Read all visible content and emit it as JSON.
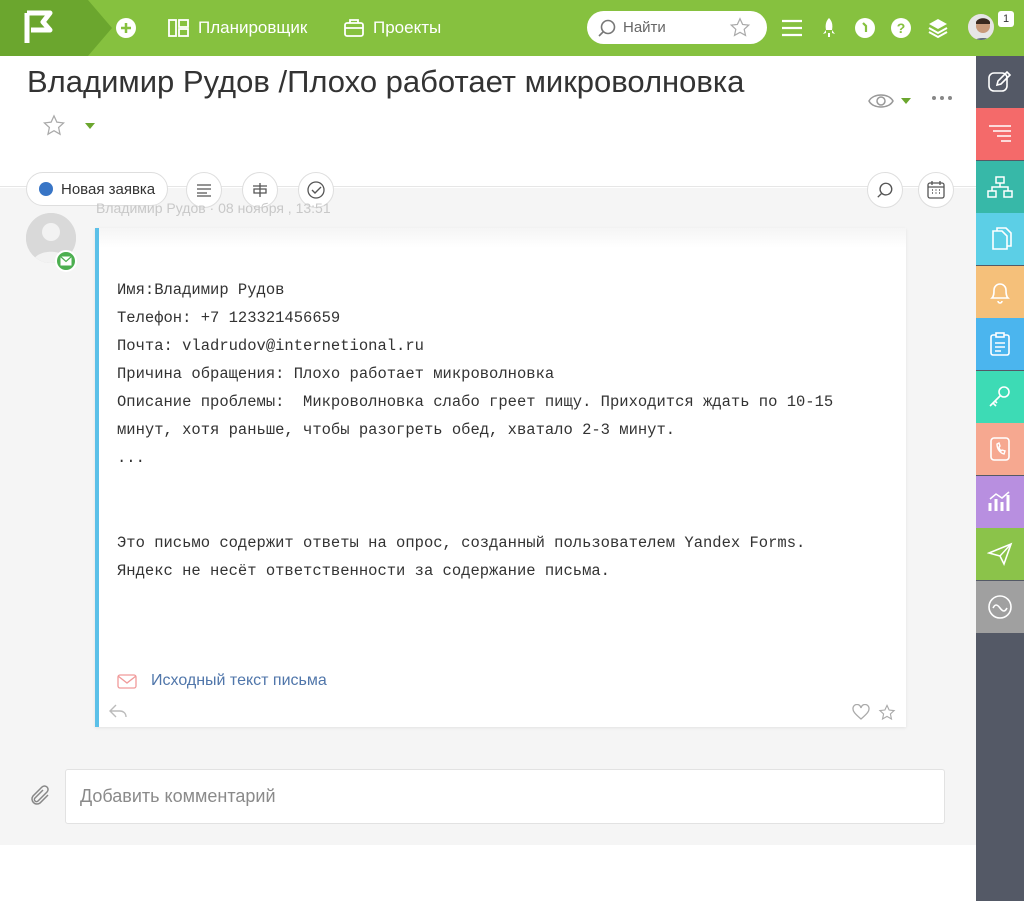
{
  "topbar": {
    "planner_label": "Планировщик",
    "projects_label": "Проекты",
    "search_placeholder": "Найти",
    "notification_count": "1"
  },
  "task": {
    "title": "Владимир Рудов /Плохо работает микроволновка",
    "status": "Новая заявка"
  },
  "message": {
    "meta": "Владимир Рудов · 08 ноября , 13:51",
    "lines": [
      "Имя:Владимир Рудов",
      "Телефон: +7 123321456659",
      "Почта: vladrudov@internetional.ru",
      "Причина обращения: Плохо работает микроволновка",
      "Описание проблемы:  Микроволновка слабо греет пищу. Приходится ждать по 10-15",
      "минут, хотя раньше, чтобы разогреть обед, хватало 2-3 минут.",
      "..."
    ],
    "footer_lines": [
      "Это письмо содержит ответы на опрос, созданный пользователем Yandex Forms.",
      "Яндекс не несёт ответственности за содержание письма."
    ],
    "original_link": "Исходный текст письма"
  },
  "comment": {
    "placeholder": "Добавить комментарий"
  },
  "colors": {
    "topbar": "#86c13f",
    "rightbar": "#545966",
    "status_dot": "#3875c6",
    "card_accent": "#5bc0e8"
  },
  "rightbar_items": [
    {
      "icon": "edit-icon",
      "color": "#545966"
    },
    {
      "icon": "list-icon",
      "color": "#f46a6a"
    },
    {
      "icon": "org-chart-icon",
      "color": "#37b8a8"
    },
    {
      "icon": "documents-icon",
      "color": "#5ccfe6"
    },
    {
      "icon": "bell-icon",
      "color": "#f5c07a"
    },
    {
      "icon": "clipboard-icon",
      "color": "#4bb5ee"
    },
    {
      "icon": "key-icon",
      "color": "#3ddbb5"
    },
    {
      "icon": "phone-book-icon",
      "color": "#f6a890"
    },
    {
      "icon": "analytics-icon",
      "color": "#b88fe0"
    },
    {
      "icon": "send-icon",
      "color": "#8bc34a"
    },
    {
      "icon": "wave-icon",
      "color": "#a0a0a0"
    }
  ]
}
